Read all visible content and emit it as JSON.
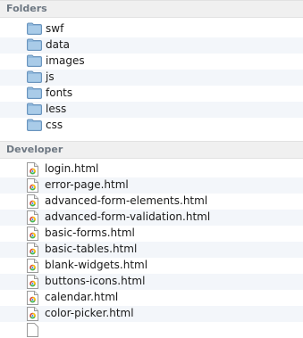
{
  "sections": {
    "folders": {
      "title": "Folders",
      "items": [
        {
          "name": "swf",
          "icon": "folder-icon"
        },
        {
          "name": "data",
          "icon": "folder-icon"
        },
        {
          "name": "images",
          "icon": "folder-icon"
        },
        {
          "name": "js",
          "icon": "folder-icon"
        },
        {
          "name": "fonts",
          "icon": "folder-icon"
        },
        {
          "name": "less",
          "icon": "folder-icon"
        },
        {
          "name": "css",
          "icon": "folder-icon"
        }
      ]
    },
    "developer": {
      "title": "Developer",
      "items": [
        {
          "name": "login.html",
          "icon": "html-file-icon"
        },
        {
          "name": "error-page.html",
          "icon": "html-file-icon"
        },
        {
          "name": "advanced-form-elements.html",
          "icon": "html-file-icon"
        },
        {
          "name": "advanced-form-validation.html",
          "icon": "html-file-icon"
        },
        {
          "name": "basic-forms.html",
          "icon": "html-file-icon"
        },
        {
          "name": "basic-tables.html",
          "icon": "html-file-icon"
        },
        {
          "name": "blank-widgets.html",
          "icon": "html-file-icon"
        },
        {
          "name": "buttons-icons.html",
          "icon": "html-file-icon"
        },
        {
          "name": "calendar.html",
          "icon": "html-file-icon"
        },
        {
          "name": "color-picker.html",
          "icon": "html-file-icon"
        }
      ]
    }
  },
  "colors": {
    "header_bg": "#f0f0f0",
    "header_text": "#6d7782",
    "alt_row": "#f3f6fa",
    "folder_blue": "#8fb8dc"
  }
}
